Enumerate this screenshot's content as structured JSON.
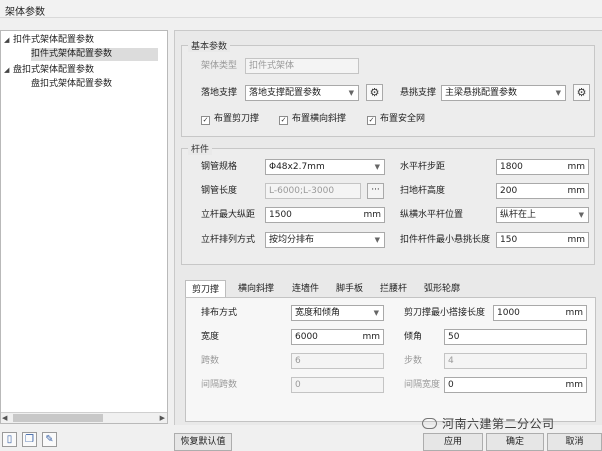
{
  "window": {
    "title": "架体参数"
  },
  "tree": {
    "nodes": [
      {
        "label": "扣件式架体配置参数",
        "toggle": "◢",
        "level": 0
      },
      {
        "label": "扣件式架体配置参数",
        "level": 1,
        "selected": true
      },
      {
        "label": "盘扣式架体配置参数",
        "toggle": "◢",
        "level": 0
      },
      {
        "label": "盘扣式架体配置参数",
        "level": 1
      }
    ]
  },
  "basic": {
    "title": "基本参数",
    "frame_type_label": "架体类型",
    "frame_type_value": "扣件式架体",
    "floor_support_label": "落地支撑",
    "floor_support_value": "落地支撑配置参数",
    "cantilever_label": "悬挑支撑",
    "cantilever_value": "主梁悬挑配置参数",
    "chk_scissor": "布置剪刀撑",
    "chk_diagonal": "布置横向斜撑",
    "chk_safetynet": "布置安全网"
  },
  "member": {
    "title": "杆件",
    "pipe_spec_label": "钢管规格",
    "pipe_spec_value": "Φ48x2.7mm",
    "h_step_label": "水平杆步距",
    "h_step_value": "1800",
    "pipe_len_label": "钢管长度",
    "pipe_len_value": "L-6000;L-3000",
    "sweep_label": "扫地杆高度",
    "sweep_value": "200",
    "max_span_label": "立杆最大纵距",
    "max_span_value": "1500",
    "long_pos_label": "纵横水平杆位置",
    "long_pos_value": "纵杆在上",
    "arrange_label": "立杆排列方式",
    "arrange_value": "按均分排布",
    "min_overhang_label": "扣件杆件最小悬挑长度",
    "min_overhang_value": "150",
    "unit": "mm",
    "more": "···"
  },
  "tabs": [
    "剪刀撑",
    "横向斜撑",
    "连墙件",
    "脚手板",
    "拦腰杆",
    "弧形轮廓"
  ],
  "scissor": {
    "arrange_label": "排布方式",
    "arrange_value": "宽度和倾角",
    "min_lap_label": "剪刀撑最小搭接长度",
    "min_lap_value": "1000",
    "width_label": "宽度",
    "width_value": "6000",
    "angle_label": "倾角",
    "angle_value": "50",
    "spans_label": "跨数",
    "spans_value": "6",
    "steps_label": "步数",
    "steps_value": "4",
    "gap_spans_label": "间隔跨数",
    "gap_spans_value": "0",
    "gap_width_label": "间隔宽度",
    "gap_width_value": "0",
    "unit": "mm"
  },
  "icons": {
    "gear": "⚙",
    "dropdown": "▼",
    "check": "✓",
    "arrow_left": "◀",
    "arrow_right": "▶"
  },
  "buttons": {
    "restore": "恢复默认值",
    "apply": "应用",
    "ok": "确定",
    "cancel": "取消"
  },
  "watermark": "河南六建第二分公司"
}
